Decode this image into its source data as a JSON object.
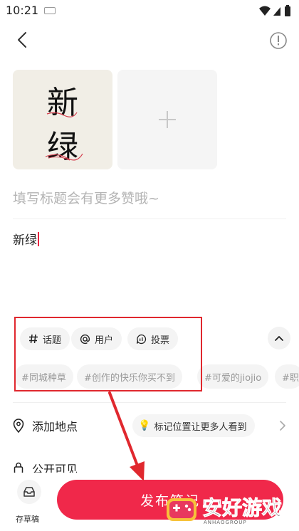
{
  "status_bar": {
    "time": "10:21"
  },
  "image_slot": {
    "caption_line1": "新",
    "caption_line2": "绿"
  },
  "editor": {
    "title_placeholder": "填写标题会有更多赞哦~",
    "body_value": "新绿"
  },
  "tools": [
    {
      "label": "话题",
      "icon": "hash-icon"
    },
    {
      "label": "用户",
      "icon": "at-icon"
    },
    {
      "label": "投票",
      "icon": "poll-icon"
    }
  ],
  "suggested_topics": [
    "#同城种草",
    "#创作的快乐你买不到",
    "#可爱的jiojio",
    "#职"
  ],
  "location": {
    "label": "添加地点",
    "hint": "标记位置让更多人看到"
  },
  "privacy": {
    "label": "公开可见"
  },
  "bottom": {
    "draft_label": "存草稿",
    "publish_label": "发布笔记"
  },
  "watermark": {
    "brand": "安好游戏",
    "url": "ANHAOGROUP"
  },
  "colors": {
    "accent": "#f0284a",
    "annotation": "#e0282e"
  }
}
